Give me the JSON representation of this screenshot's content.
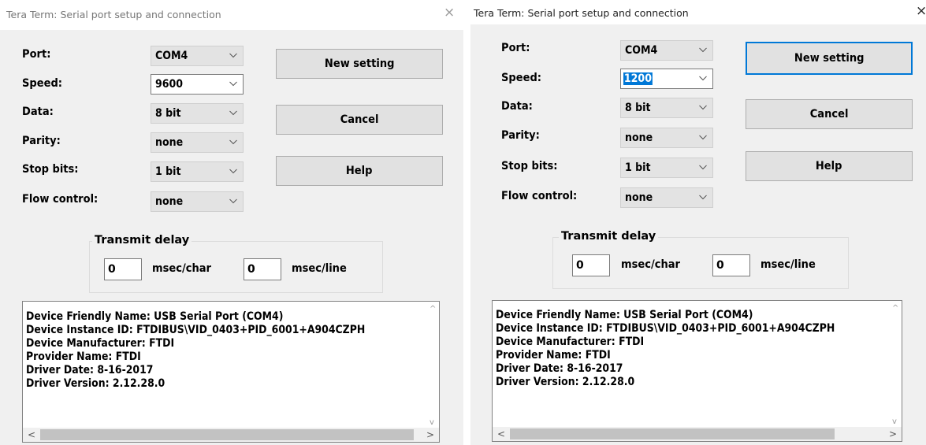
{
  "dialogs": [
    {
      "title": "Tera Term: Serial port setup and connection",
      "close_glyph": "×",
      "labels": {
        "port": "Port:",
        "speed": "Speed:",
        "data": "Data:",
        "parity": "Parity:",
        "stop_bits": "Stop bits:",
        "flow_control": "Flow control:"
      },
      "values": {
        "port": "COM4",
        "speed": "9600",
        "data": "8 bit",
        "parity": "none",
        "stop_bits": "1 bit",
        "flow_control": "none"
      },
      "speed_selected": false,
      "buttons": {
        "new_setting": "New setting",
        "cancel": "Cancel",
        "help": "Help"
      },
      "transmit_delay": {
        "title": "Transmit delay",
        "char_value": "0",
        "char_unit": "msec/char",
        "line_value": "0",
        "line_unit": "msec/line"
      },
      "device_info": [
        "Device Friendly Name: USB Serial Port (COM4)",
        "Device Instance ID: FTDIBUS\\VID_0403+PID_6001+A904CZPH",
        "Device Manufacturer: FTDI",
        "Provider Name: FTDI",
        "Driver Date: 8-16-2017",
        "Driver Version: 2.12.28.0"
      ],
      "scroll_glyphs": {
        "up": "^",
        "down": "v",
        "left": "<",
        "right": ">"
      }
    },
    {
      "title": "Tera Term: Serial port setup and connection",
      "close_glyph": "×",
      "labels": {
        "port": "Port:",
        "speed": "Speed:",
        "data": "Data:",
        "parity": "Parity:",
        "stop_bits": "Stop bits:",
        "flow_control": "Flow control:"
      },
      "values": {
        "port": "COM4",
        "speed": "1200",
        "data": "8 bit",
        "parity": "none",
        "stop_bits": "1 bit",
        "flow_control": "none"
      },
      "speed_selected": true,
      "buttons": {
        "new_setting": "New setting",
        "cancel": "Cancel",
        "help": "Help"
      },
      "transmit_delay": {
        "title": "Transmit delay",
        "char_value": "0",
        "char_unit": "msec/char",
        "line_value": "0",
        "line_unit": "msec/line"
      },
      "device_info": [
        "Device Friendly Name: USB Serial Port (COM4)",
        "Device Instance ID: FTDIBUS\\VID_0403+PID_6001+A904CZPH",
        "Device Manufacturer: FTDI",
        "Provider Name: FTDI",
        "Driver Date: 8-16-2017",
        "Driver Version: 2.12.28.0"
      ],
      "scroll_glyphs": {
        "up": "^",
        "down": "v",
        "left": "<",
        "right": ">"
      }
    }
  ]
}
